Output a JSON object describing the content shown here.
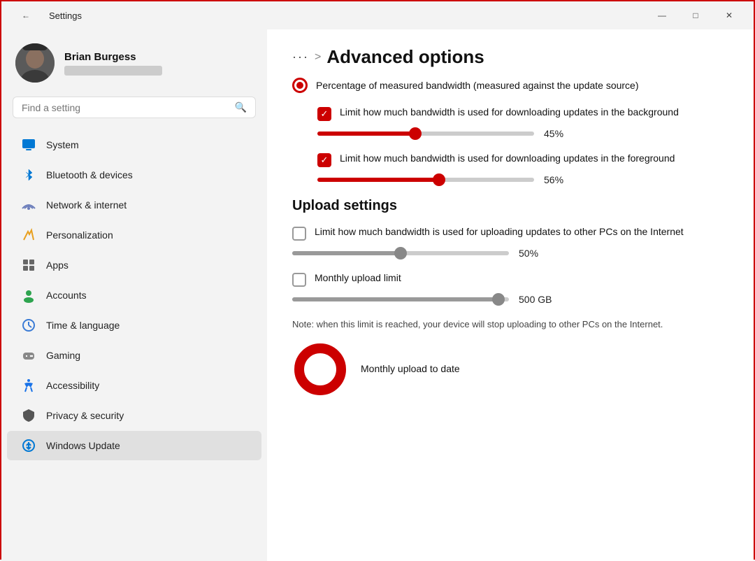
{
  "titleBar": {
    "title": "Settings",
    "backIcon": "←",
    "minimizeIcon": "—",
    "maximizeIcon": "□",
    "closeIcon": "✕"
  },
  "sidebar": {
    "user": {
      "name": "Brian Burgess"
    },
    "search": {
      "placeholder": "Find a setting"
    },
    "navItems": [
      {
        "id": "system",
        "label": "System",
        "icon": "🖥",
        "active": false
      },
      {
        "id": "bluetooth",
        "label": "Bluetooth & devices",
        "icon": "⬡",
        "active": false
      },
      {
        "id": "network",
        "label": "Network & internet",
        "icon": "📶",
        "active": false
      },
      {
        "id": "personalization",
        "label": "Personalization",
        "icon": "✏",
        "active": false
      },
      {
        "id": "apps",
        "label": "Apps",
        "icon": "📦",
        "active": false
      },
      {
        "id": "accounts",
        "label": "Accounts",
        "icon": "👤",
        "active": false
      },
      {
        "id": "time",
        "label": "Time & language",
        "icon": "🌐",
        "active": false
      },
      {
        "id": "gaming",
        "label": "Gaming",
        "icon": "🎮",
        "active": false
      },
      {
        "id": "accessibility",
        "label": "Accessibility",
        "icon": "♿",
        "active": false
      },
      {
        "id": "privacy",
        "label": "Privacy & security",
        "icon": "🛡",
        "active": false
      },
      {
        "id": "windowsupdate",
        "label": "Windows Update",
        "icon": "🔄",
        "active": true
      }
    ]
  },
  "main": {
    "breadcrumb": {
      "dots": "···",
      "separator": ">",
      "title": "Advanced options"
    },
    "download": {
      "radioLabel": "Percentage of measured bandwidth (measured against the update source)",
      "bg": {
        "checkLabel": "Limit how much bandwidth is used for downloading updates in the background",
        "sliderPct": 45,
        "sliderValue": "45%"
      },
      "fg": {
        "checkLabel": "Limit how much bandwidth is used for downloading updates in the foreground",
        "sliderPct": 56,
        "sliderValue": "56%"
      }
    },
    "upload": {
      "sectionTitle": "Upload settings",
      "internet": {
        "checkLabel": "Limit how much bandwidth is used for uploading updates to other PCs on the Internet",
        "sliderPct": 50,
        "sliderValue": "50%"
      },
      "monthly": {
        "checkLabel": "Monthly upload limit",
        "sliderPct": 95,
        "sliderValue": "500 GB"
      },
      "note": "Note: when this limit is reached, your device will stop uploading to other PCs on the Internet.",
      "donut": {
        "label": "Monthly upload to date"
      }
    }
  }
}
